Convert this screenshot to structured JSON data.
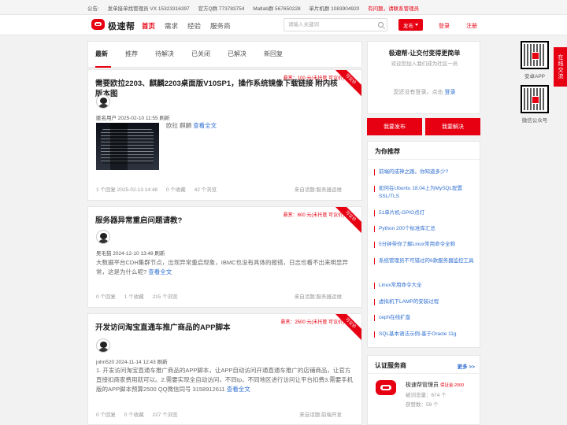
{
  "topbar": {
    "announcement": "公告:",
    "mentor": "发单接单找管理员 VX 15323316397",
    "qq_group": "官方Q群 773783754",
    "matlab_group": "Matlab群 567650228",
    "mcu_group": "单片机群 1083904920",
    "help": "有问题，请联系管理员"
  },
  "header": {
    "brand": "极速帮",
    "nav": [
      "首页",
      "需求",
      "经验",
      "服务商"
    ],
    "search_placeholder": "请输入关键词",
    "publish_label": "发布",
    "login": "登录",
    "register": "注册"
  },
  "tabs": [
    "最新",
    "推荐",
    "待解决",
    "已关闭",
    "已解决",
    "新回复"
  ],
  "questions": [
    {
      "title": "需要欧拉2203、麒麟2203桌面版V10SP1，操作系统镜像下载链接 附内核版本图",
      "bounty": "悬赏：100 元(未托管 可议价)",
      "ribbon": "可议价",
      "author_meta": "匿名用户 2025-02-10 11:55 刷新",
      "description": "欧拉 麒麟",
      "more": "查看全文",
      "answers": "1 个回复 2025-02-13 14:48",
      "favorites": "0 个收藏",
      "views": "42 个浏览",
      "source": "来自话题:服务器运维"
    },
    {
      "title": "服务器异常重启问题请教?",
      "bounty": "悬赏：600 元(未托管 可议价)",
      "ribbon": "可议价",
      "author_meta": "吴毛猫 2024-12-10 13:48 刷新",
      "description": "大数据平台CDH集群节点，出现异常重启现象，IBMC也没有具体的报错，日志也看不出来明显异常，这是为什么呢?",
      "more": "查看全文",
      "answers": "0 个回复",
      "favorites": "1 个收藏",
      "views": "215 个浏览",
      "source": "来自话题:服务器运维"
    },
    {
      "title": "开发访问淘宝直通车推广商品的APP脚本",
      "bounty": "悬赏：2500 元(未托管 可议价)",
      "ribbon": "可议价",
      "author_meta": "john520 2024-11-14 12:43 刷新",
      "description": "1. 开发访问淘宝直通车推广商品的APP脚本，让APP自动访问开通直通车推广的店铺商品，让官方直接扣商家费用就可以。2.需要实现全自动访问，不同Ip，不同地区进行访问让平台扣费3.需要手机版的APP脚本预算2500 QQ微信同号 3158912611",
      "more": "查看全文",
      "answers": "0 个回复",
      "favorites": "0 个收藏",
      "views": "227 个浏览",
      "source": "来自话题:前端开发"
    }
  ],
  "sidebar": {
    "welcome_title": "极速帮-让交付变得更简单",
    "welcome_sub": "欢迎您加入我们成为社区一员",
    "login_prompt": "您还没有登录。点击",
    "login_link": "登录",
    "ask_btn": "我要发布",
    "solve_btn": "我要解决",
    "recommend_title": "为你推荐",
    "recommend": [
      "前端的成神之路。你知道多少?",
      "如何在Ubuntu 18.04上为MySQL配置SSL/TLS",
      "51单片机-GPIO点灯",
      "Python 200个标准库汇总",
      "5分钟带你了解Linux常用命令全称",
      "系统管理员不可错过的6款服务器监控工具",
      "Linux常用命令大全",
      "虚拟机下LAMP的安装过程",
      "ceph在线扩盘",
      "SQL基本语法示例-基于Oracle 11g"
    ],
    "service_title": "认证服务商",
    "more": "更多 >>",
    "service_name": "极速帮管理员",
    "deposit": "保证金:2000",
    "service_views": "被浏览量：674 个",
    "service_likes": "获赞数：59 个"
  },
  "qrs": {
    "app": "安卓APP",
    "wechat": "微信公众号",
    "online": "在线交流"
  }
}
